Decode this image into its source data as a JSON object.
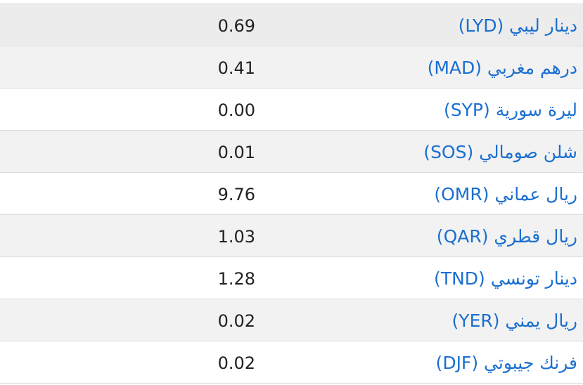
{
  "rates": [
    {
      "currency": "دينار ليبي (LYD)",
      "value": "0.69"
    },
    {
      "currency": "درهم مغربي (MAD)",
      "value": "0.41"
    },
    {
      "currency": "ليرة سورية (SYP)",
      "value": "0.00"
    },
    {
      "currency": "شلن صومالي (SOS)",
      "value": "0.01"
    },
    {
      "currency": "ريال عماني (OMR)",
      "value": "9.76"
    },
    {
      "currency": "ريال قطري (QAR)",
      "value": "1.03"
    },
    {
      "currency": "دينار تونسي (TND)",
      "value": "1.28"
    },
    {
      "currency": "ريال يمني (YER)",
      "value": "0.02"
    },
    {
      "currency": "فرنك جيبوتي (DJF)",
      "value": "0.02"
    }
  ],
  "colors": {
    "link": "#1a6fd0",
    "text": "#222222",
    "row_alt": "#f2f2f2",
    "border": "#dcdcdc"
  }
}
